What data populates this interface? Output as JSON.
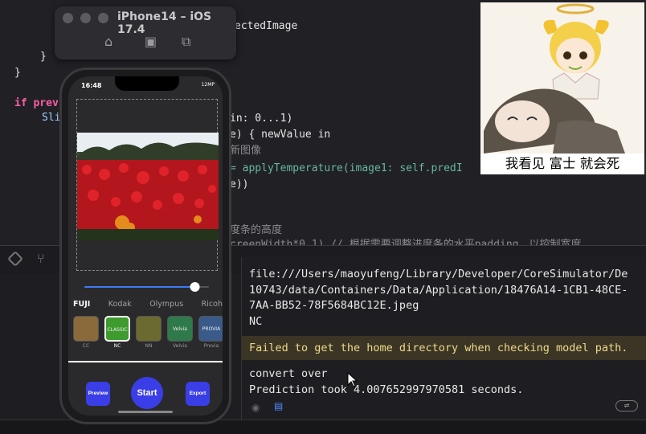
{
  "simulator": {
    "title": "iPhone14 – iOS 17.4"
  },
  "code": {
    "lines": [
      "ectedImage",
      "}",
      "}",
      "if prev",
      "Sli",
      "in: 0...1)",
      "e) { newValue in",
      "新图像",
      "= applyTemperature(image1: self.predI",
      "e))",
      "度条的高度",
      "creenWidth*0.1) // 根据需要调整进度条的水平padding，以控制宽度"
    ]
  },
  "phone": {
    "time": "16:48",
    "status": "12MP",
    "brands": [
      "FUJI",
      "Kodak",
      "Olympus",
      "Ricoh"
    ],
    "films": [
      {
        "label": "CC",
        "name": "",
        "color": "#8a6a3a"
      },
      {
        "label": "NC",
        "name": "CLASSIC",
        "color": "#3e9b2e"
      },
      {
        "label": "NN",
        "name": "",
        "color": "#6b6b2f"
      },
      {
        "label": "Velvia",
        "name": "Velvia",
        "color": "#2f7a4a"
      },
      {
        "label": "Provia",
        "name": "PROVIA",
        "color": "#3a5a8a"
      }
    ],
    "slider_value": 0.92,
    "buttons": {
      "preview": "Preview",
      "start": "Start",
      "export": "Export"
    }
  },
  "console": {
    "lines": [
      "file:///Users/maoyufeng/Library/Developer/CoreSimulator/De",
      "10743/data/Containers/Data/Application/18476A14-1CB1-48CE-",
      "7AA-BB52-78F5684BC12E.jpeg",
      "NC"
    ],
    "warning": "Failed to get the home directory when checking model path.",
    "after": [
      "convert over",
      "Prediction took 4.007652997970581 seconds."
    ]
  },
  "meme": {
    "caption": "我看见 富士 就会死"
  }
}
